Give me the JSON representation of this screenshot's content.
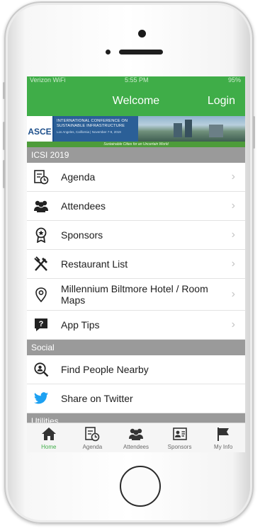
{
  "status_bar": {
    "carrier": "Verizon WiFi",
    "time": "5:55 PM",
    "battery": "95%"
  },
  "nav": {
    "title": "Welcome",
    "login_label": "Login"
  },
  "banner": {
    "logo_text": "ASCE",
    "headline": "INTERNATIONAL CONFERENCE ON SUSTAINABLE INFRASTRUCTURE",
    "subline": "Los Angeles, California | November 7-9, 2019",
    "tagline": "Sustainable Cities for an Uncertain World"
  },
  "sections": [
    {
      "title": "ICSI 2019",
      "items": [
        {
          "label": "Agenda",
          "icon": "agenda-icon"
        },
        {
          "label": "Attendees",
          "icon": "attendees-icon"
        },
        {
          "label": "Sponsors",
          "icon": "sponsor-ribbon-icon"
        },
        {
          "label": "Restaurant List",
          "icon": "fork-knife-icon"
        },
        {
          "label": "Millennium Biltmore Hotel / Room Maps",
          "icon": "map-pin-icon"
        },
        {
          "label": "App Tips",
          "icon": "help-bubble-icon"
        }
      ]
    },
    {
      "title": "Social",
      "items": [
        {
          "label": "Find People Nearby",
          "icon": "person-search-icon"
        },
        {
          "label": "Share on Twitter",
          "icon": "twitter-icon"
        }
      ]
    },
    {
      "title": "Utilities",
      "items": []
    }
  ],
  "tabs": [
    {
      "label": "Home",
      "icon": "home-icon",
      "active": true
    },
    {
      "label": "Agenda",
      "icon": "agenda-icon"
    },
    {
      "label": "Attendees",
      "icon": "attendees-icon"
    },
    {
      "label": "Sponsors",
      "icon": "sponsors-icon"
    },
    {
      "label": "My Info",
      "icon": "flag-icon"
    }
  ],
  "colors": {
    "brand_green": "#3fad48",
    "section_gray": "#9a9a9a",
    "twitter_blue": "#1da1f2"
  }
}
